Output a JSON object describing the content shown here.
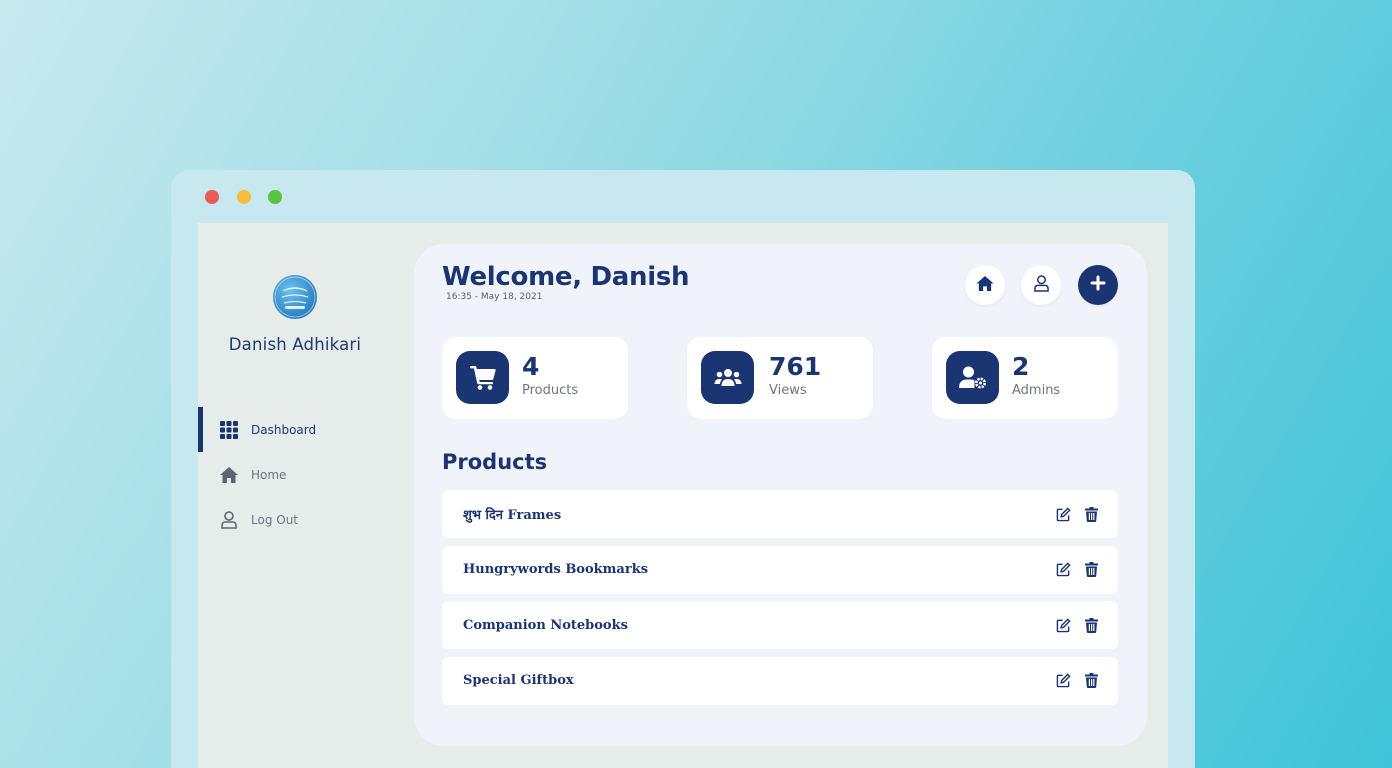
{
  "colors": {
    "primary": "#1a3572",
    "window_dots": [
      "#ec5a55",
      "#f6bd3a",
      "#5ac43f"
    ],
    "card_bg": "#ffffff",
    "main_bg": "#f1f3fa"
  },
  "sidebar": {
    "user_name": "Danish Adhikari",
    "items": [
      {
        "label": "Dashboard",
        "icon": "grid-icon",
        "active": true
      },
      {
        "label": "Home",
        "icon": "home-icon",
        "active": false
      },
      {
        "label": "Log Out",
        "icon": "user-icon",
        "active": false
      }
    ]
  },
  "header": {
    "welcome": "Welcome, Danish",
    "datetime": "16:35 - May 18, 2021",
    "buttons": [
      "home-icon",
      "user-icon",
      "plus-icon"
    ]
  },
  "stats": [
    {
      "value": "4",
      "label": "Products",
      "icon": "cart-icon"
    },
    {
      "value": "761",
      "label": "Views",
      "icon": "users-icon"
    },
    {
      "value": "2",
      "label": "Admins",
      "icon": "user-cog-icon"
    }
  ],
  "products": {
    "title": "Products",
    "items": [
      {
        "name": "शुभ दिन Frames"
      },
      {
        "name": "Hungrywords Bookmarks"
      },
      {
        "name": "Companion Notebooks"
      },
      {
        "name": "Special Giftbox"
      }
    ]
  }
}
